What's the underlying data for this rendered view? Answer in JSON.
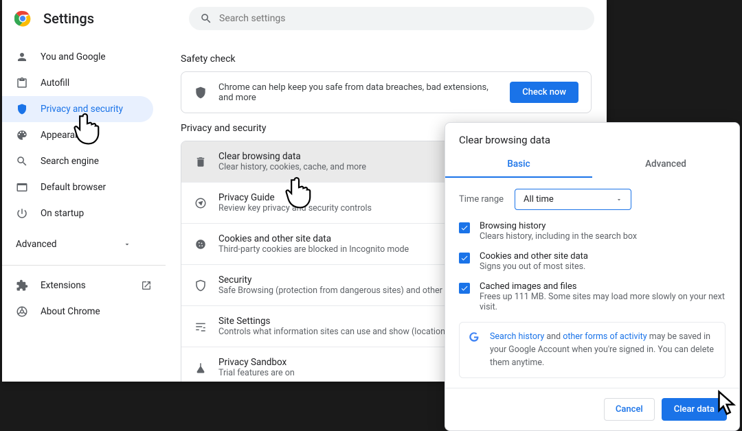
{
  "title": "Settings",
  "search": {
    "placeholder": "Search settings"
  },
  "sidebar": {
    "items": [
      {
        "label": "You and Google"
      },
      {
        "label": "Autofill"
      },
      {
        "label": "Privacy and security"
      },
      {
        "label": "Appearance"
      },
      {
        "label": "Search engine"
      },
      {
        "label": "Default browser"
      },
      {
        "label": "On startup"
      }
    ],
    "advanced": "Advanced",
    "footer": {
      "extensions": "Extensions",
      "about": "About Chrome"
    }
  },
  "safety": {
    "section": "Safety check",
    "text": "Chrome can help keep you safe from data breaches, bad extensions, and more",
    "button": "Check now"
  },
  "privacy": {
    "section": "Privacy and security",
    "items": [
      {
        "title": "Clear browsing data",
        "sub": "Clear history, cookies, cache, and more"
      },
      {
        "title": "Privacy Guide",
        "sub": "Review key privacy and security controls"
      },
      {
        "title": "Cookies and other site data",
        "sub": "Third-party cookies are blocked in Incognito mode"
      },
      {
        "title": "Security",
        "sub": "Safe Browsing (protection from dangerous sites) and other security settings"
      },
      {
        "title": "Site Settings",
        "sub": "Controls what information sites can use and show (location, camera, pop-ups, and more)"
      },
      {
        "title": "Privacy Sandbox",
        "sub": "Trial features are on"
      }
    ]
  },
  "dialog": {
    "title": "Clear browsing data",
    "tabs": {
      "basic": "Basic",
      "advanced": "Advanced"
    },
    "time_label": "Time range",
    "time_value": "All time",
    "checks": [
      {
        "title": "Browsing history",
        "sub": "Clears history, including in the search box"
      },
      {
        "title": "Cookies and other site data",
        "sub": "Signs you out of most sites."
      },
      {
        "title": "Cached images and files",
        "sub": "Frees up 111 MB. Some sites may load more slowly on your next visit."
      }
    ],
    "info": {
      "link1": "Search history",
      "mid": " and ",
      "link2": "other forms of activity",
      "rest": " may be saved in your Google Account when you're signed in. You can delete them anytime."
    },
    "buttons": {
      "cancel": "Cancel",
      "clear": "Clear data"
    }
  }
}
